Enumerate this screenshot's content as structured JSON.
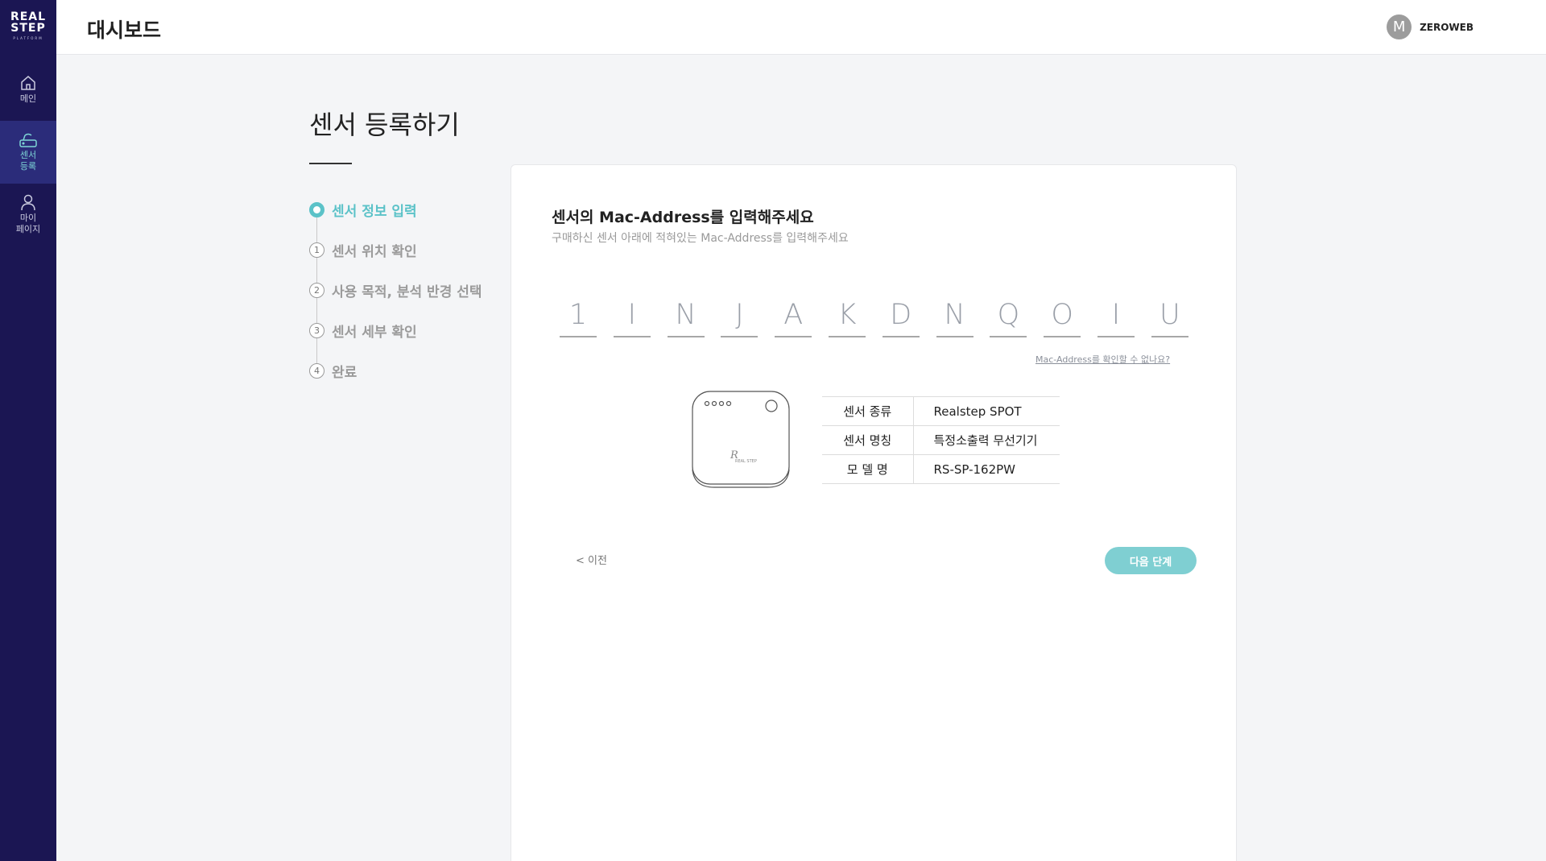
{
  "app": {
    "logo": {
      "line1": "REAL",
      "line2": "STEP",
      "line3": "PLATFORM"
    },
    "header_title": "대시보드",
    "user": {
      "avatar_initial": "M",
      "name": "ZEROWEB"
    }
  },
  "sidebar": {
    "items": [
      {
        "label": "메인",
        "icon": "home-icon"
      },
      {
        "label": "센서\n등록",
        "icon": "router-icon",
        "active": true
      },
      {
        "label": "마이\n페이지",
        "icon": "person-icon"
      }
    ]
  },
  "page": {
    "title": "센서 등록하기",
    "steps": [
      {
        "marker": "",
        "label": "센서 정보 입력",
        "active": true
      },
      {
        "marker": "1",
        "label": "센서 위치 확인"
      },
      {
        "marker": "2",
        "label": "사용 목적, 분석 반경 선택"
      },
      {
        "marker": "3",
        "label": "센서 세부 확인"
      },
      {
        "marker": "4",
        "label": "완료"
      }
    ]
  },
  "form": {
    "title": "센서의 Mac-Address를 입력해주세요",
    "subtitle": "구매하신 센서 아래에 적혀있는 Mac-Address를 입력해주세요",
    "mac_chars": [
      "1",
      "I",
      "N",
      "J",
      "A",
      "K",
      "D",
      "N",
      "Q",
      "O",
      "I",
      "U"
    ],
    "help_link": "Mac-Address를 확인할 수 없나요?",
    "device_brand": "REAL STEP",
    "info": [
      {
        "key": "센서 종류",
        "value": "Realstep SPOT"
      },
      {
        "key": "센서 명칭",
        "value": "특정소출력 무선기기"
      },
      {
        "key": "모 델 명",
        "value": "RS-SP-162PW"
      }
    ],
    "prev_label": "< 이전",
    "next_label": "다음 단계"
  },
  "colors": {
    "sidebar_bg": "#1b1653",
    "accent": "#5bc2c8",
    "next_button": "#7fcfd2"
  }
}
